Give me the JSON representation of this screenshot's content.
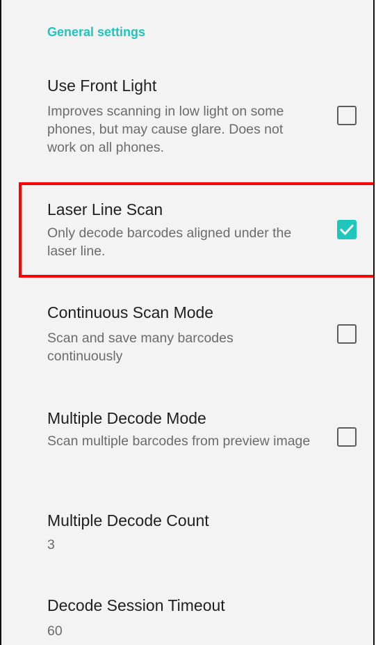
{
  "section": {
    "header": "General settings"
  },
  "prefs": [
    {
      "title": "Use Front Light",
      "summary": "Improves scanning in low light on some phones, but may cause glare. Does not work on all phones.",
      "checked": false
    },
    {
      "title": "Laser Line Scan",
      "summary": "Only decode barcodes aligned under the laser line.",
      "checked": true
    },
    {
      "title": "Continuous Scan Mode",
      "summary": "Scan and save many barcodes continuously",
      "checked": false
    },
    {
      "title": "Multiple Decode Mode",
      "summary": "Scan multiple barcodes from preview image",
      "checked": false
    },
    {
      "title": "Multiple Decode Count",
      "summary": "3"
    },
    {
      "title": "Decode Session Timeout",
      "summary": "60"
    }
  ],
  "colors": {
    "accent": "#1fc6bd",
    "highlight": "#ff0000"
  },
  "icons": {
    "checked": "check-icon"
  }
}
